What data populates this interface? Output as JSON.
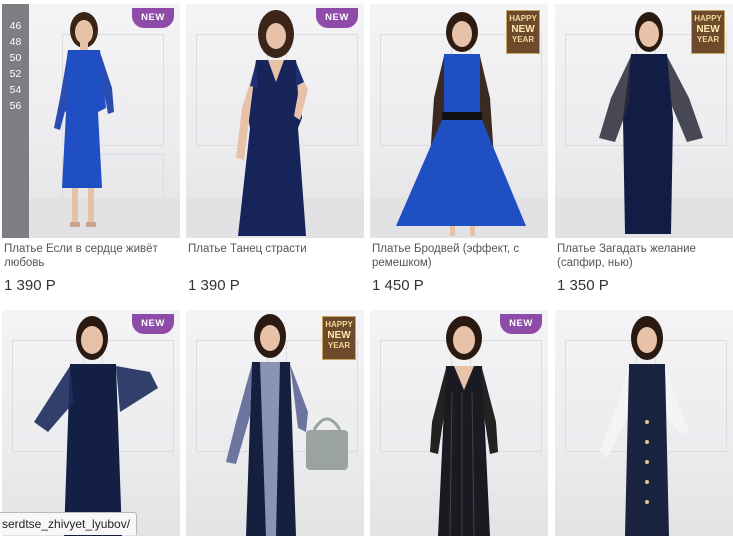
{
  "products": [
    {
      "name": "Платье Если в сердце живёт любовь",
      "price": "1 390 Р",
      "badge": "NEW",
      "sizes": [
        "46",
        "48",
        "50",
        "52",
        "54",
        "56"
      ],
      "dress_color": "#1f4fc2"
    },
    {
      "name": "Платье Танец страсти",
      "price": "1 390 Р",
      "badge": "NEW",
      "dress_color": "#16245a"
    },
    {
      "name": "Платье Бродвей (эффект, с ремешком)",
      "price": "1 450 Р",
      "badge": "HAPPY NEW YEAR",
      "dress_color": "#1f4fc2"
    },
    {
      "name": "Платье Загадать желание (сапфир, нью)",
      "price": "1 350 Р",
      "badge": "HAPPY NEW YEAR",
      "dress_color": "#111d44"
    },
    {
      "name": "",
      "price": "",
      "badge": "NEW",
      "dress_color": "#141f45"
    },
    {
      "name": "",
      "price": "",
      "badge": "HAPPY NEW YEAR",
      "dress_color": "#15203f"
    },
    {
      "name": "",
      "price": "",
      "badge": "NEW",
      "dress_color": "#1a1a22"
    },
    {
      "name": "",
      "price": "",
      "badge": "",
      "dress_color": "#1a2440"
    }
  ],
  "badges": {
    "new": "NEW",
    "hny_line1": "HAPPY",
    "hny_line2": "NEW",
    "hny_line3": "YEAR"
  },
  "status_url": "serdtse_zhivyet_lyubov/"
}
